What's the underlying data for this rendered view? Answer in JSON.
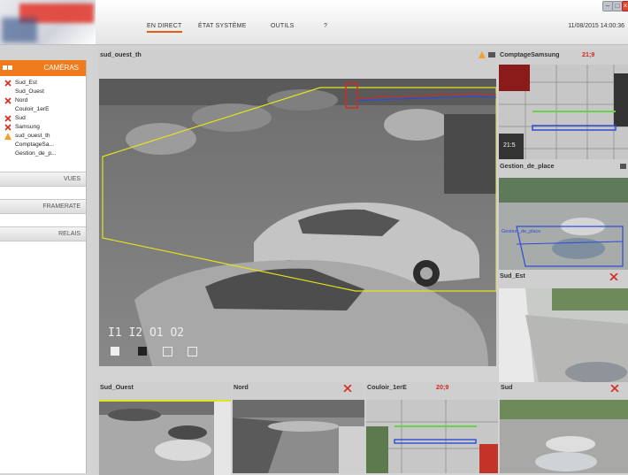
{
  "header": {
    "nav": [
      {
        "label": "EN DIRECT",
        "active": true
      },
      {
        "label": "ÉTAT SYSTÈME",
        "active": false
      },
      {
        "label": "OUTILS",
        "active": false
      },
      {
        "label": "?",
        "active": false
      }
    ],
    "datetime": "11/08/2015  14:00:36"
  },
  "sidebar": {
    "cameras_label": "CAMÉRAS",
    "cameras": [
      {
        "label": "Sud_Est",
        "status": "error"
      },
      {
        "label": "Sud_Ouest",
        "status": "ok"
      },
      {
        "label": "Nord",
        "status": "error"
      },
      {
        "label": "Couloir_1erE",
        "status": "ok"
      },
      {
        "label": "Sud",
        "status": "error"
      },
      {
        "label": "Samsung",
        "status": "error"
      },
      {
        "label": "sud_ouest_th",
        "status": "warning"
      },
      {
        "label": "ComptageSa...",
        "status": "ok"
      },
      {
        "label": "Gestion_de_p...",
        "status": "ok"
      }
    ],
    "sections": [
      "VUES",
      "FRAMERATE",
      "RELAIS"
    ]
  },
  "main_view": {
    "title": "sud_ouest_th",
    "overlay": [
      "I1",
      "I2",
      "O1",
      "O2"
    ]
  },
  "side_views": [
    {
      "title": "ComptageSamsung",
      "count": "21;9",
      "timestamp": "21:5"
    },
    {
      "title": "Gestion_de_place",
      "zone_label": "Gestion_de_place"
    },
    {
      "title": "Sud_Est"
    }
  ],
  "bottom_views": [
    {
      "title": "Sud_Ouest"
    },
    {
      "title": "Nord"
    },
    {
      "title": "Couloir_1erE",
      "count": "20;9"
    },
    {
      "title": "Sud"
    }
  ],
  "colors": {
    "accent": "#f07b1d",
    "alert": "#d42a1f",
    "zone": "#e3e31a"
  }
}
